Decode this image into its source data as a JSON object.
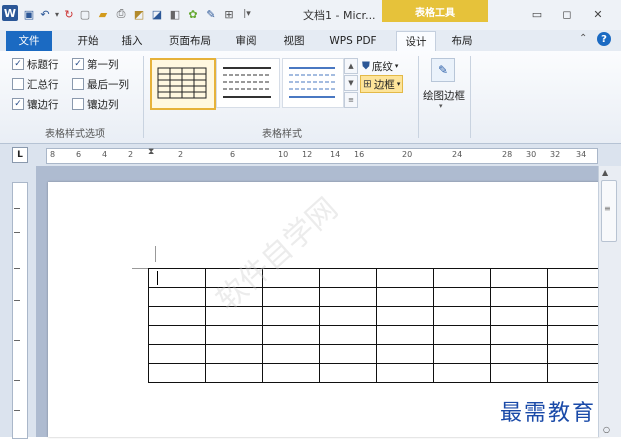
{
  "titlebar": {
    "app_icon": "W",
    "doc_title": "文档1 - Micr...",
    "tools_tab": "表格工具",
    "qat_icons": [
      "save-icon",
      "undo-icon",
      "redo-icon",
      "new-icon",
      "open-icon",
      "print-icon",
      "preview-icon",
      "spell-icon",
      "format-painter-icon",
      "pen-icon",
      "org-icon"
    ]
  },
  "tabs": [
    "文件",
    "开始",
    "插入",
    "页面布局",
    "审阅",
    "视图",
    "WPS PDF",
    "设计",
    "布局"
  ],
  "ribbon": {
    "options": {
      "items": [
        {
          "label": "标题行",
          "checked": true
        },
        {
          "label": "第一列",
          "checked": true
        },
        {
          "label": "汇总行",
          "checked": false
        },
        {
          "label": "最后一列",
          "checked": false
        },
        {
          "label": "镶边行",
          "checked": true
        },
        {
          "label": "镶边列",
          "checked": false
        }
      ],
      "group_label": "表格样式选项"
    },
    "styles": {
      "shading_label": "底纹",
      "border_label": "边框",
      "group_label": "表格样式"
    },
    "draw": {
      "label": "绘图边框"
    }
  },
  "ruler": {
    "numbers": [
      "8",
      "6",
      "4",
      "2",
      "2",
      "6",
      "10",
      "12",
      "14",
      "16",
      "20",
      "24",
      "28",
      "30",
      "32",
      "34"
    ]
  },
  "watermark": "软件自学网",
  "brand": "最需教育",
  "colors": {
    "accent": "#1b6ac2",
    "tools_tab": "#e6c23a",
    "highlight": "#fde49a"
  }
}
